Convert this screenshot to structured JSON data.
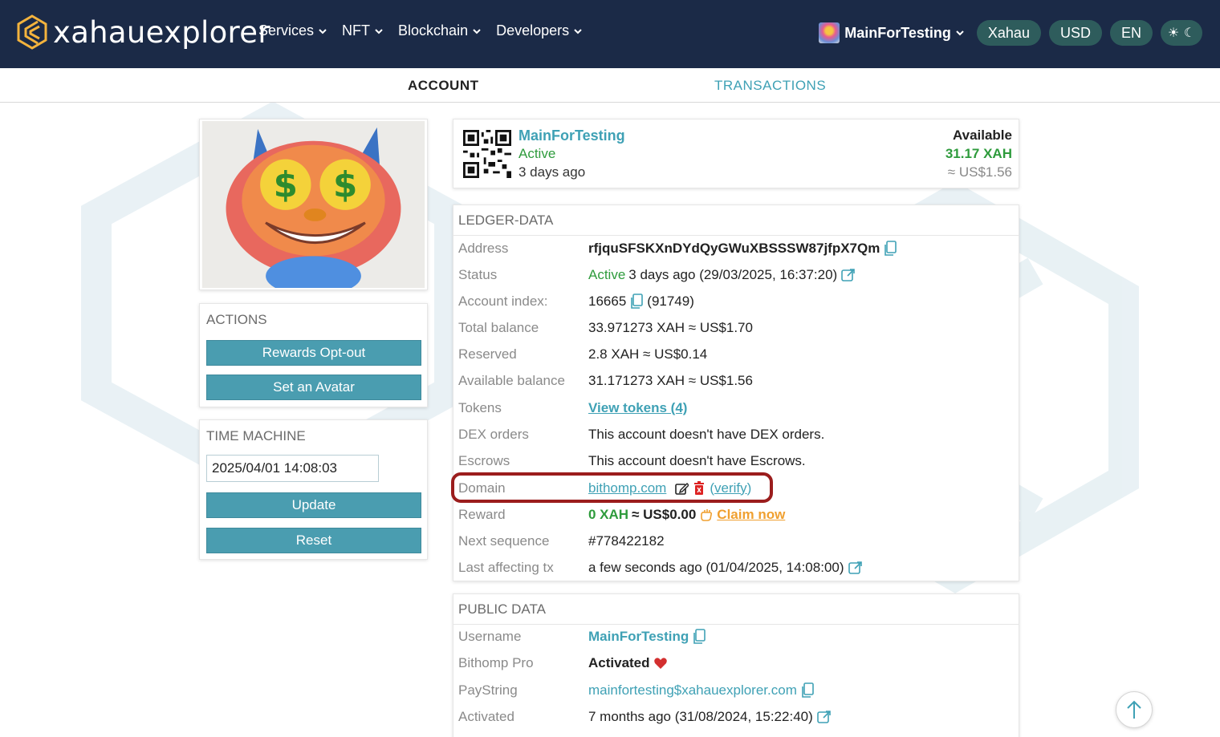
{
  "brand": {
    "logo_text": "xahauexplorer"
  },
  "nav": {
    "items": [
      {
        "label": "Services"
      },
      {
        "label": "NFT"
      },
      {
        "label": "Blockchain"
      },
      {
        "label": "Developers"
      }
    ]
  },
  "header_right": {
    "username": "MainForTesting",
    "network": "Xahau",
    "currency": "USD",
    "language": "EN"
  },
  "tabs": {
    "account": "ACCOUNT",
    "transactions": "TRANSACTIONS"
  },
  "actions": {
    "title": "ACTIONS",
    "rewards_optout": "Rewards Opt-out",
    "set_avatar": "Set an Avatar"
  },
  "time_machine": {
    "title": "TIME MACHINE",
    "value": "2025/04/01 14:08:03",
    "update": "Update",
    "reset": "Reset"
  },
  "summary": {
    "name": "MainForTesting",
    "status": "Active",
    "ago": "3 days ago",
    "available_label": "Available",
    "available_xah": "31.17 XAH",
    "available_usd": "≈ US$1.56"
  },
  "ledger": {
    "title": "LEDGER-DATA",
    "address_label": "Address",
    "address": "rfjquSFSKXnDYdQyGWuXBSSSW87jfpX7Qm",
    "status_label": "Status",
    "status_active": "Active",
    "status_rest": "3 days ago (29/03/2025, 16:37:20)",
    "index_label": "Account index:",
    "index_value": "16665",
    "index_extra": "(91749)",
    "total_label": "Total balance",
    "total_value": "33.971273 XAH ≈ US$1.70",
    "reserved_label": "Reserved",
    "reserved_value": "2.8 XAH ≈ US$0.14",
    "avail_label": "Available balance",
    "avail_value": "31.171273 XAH ≈ US$1.56",
    "tokens_label": "Tokens",
    "tokens_value": "View tokens (4)",
    "dex_label": "DEX orders",
    "dex_value": "This account doesn't have DEX orders.",
    "escrow_label": "Escrows",
    "escrow_value": "This account doesn't have Escrows.",
    "domain_label": "Domain",
    "domain_value": "bithomp.com",
    "domain_verify_open": "(",
    "domain_verify": "verify",
    "domain_verify_close": ")",
    "reward_label": "Reward",
    "reward_xah": "0 XAH",
    "reward_usd": "≈ US$0.00",
    "reward_claim": "Claim now",
    "seq_label": "Next sequence",
    "seq_value": "#778422182",
    "lasttx_label": "Last affecting tx",
    "lasttx_value": "a few seconds ago (01/04/2025, 14:08:00)"
  },
  "public": {
    "title": "PUBLIC DATA",
    "username_label": "Username",
    "username_value": "MainForTesting",
    "pro_label": "Bithomp Pro",
    "pro_value": "Activated",
    "paystring_label": "PayString",
    "paystring_value": "mainfortesting$xahauexplorer.com",
    "activated_label": "Activated",
    "activated_value": "7 months ago (31/08/2024, 15:22:40)"
  },
  "colors": {
    "header_bg": "#1b2a47",
    "accent": "#3fa1b5",
    "button": "#4a9db0",
    "active_green": "#2e9b3c",
    "claim_orange": "#f0a030",
    "highlight_red": "#9b1d1d"
  }
}
